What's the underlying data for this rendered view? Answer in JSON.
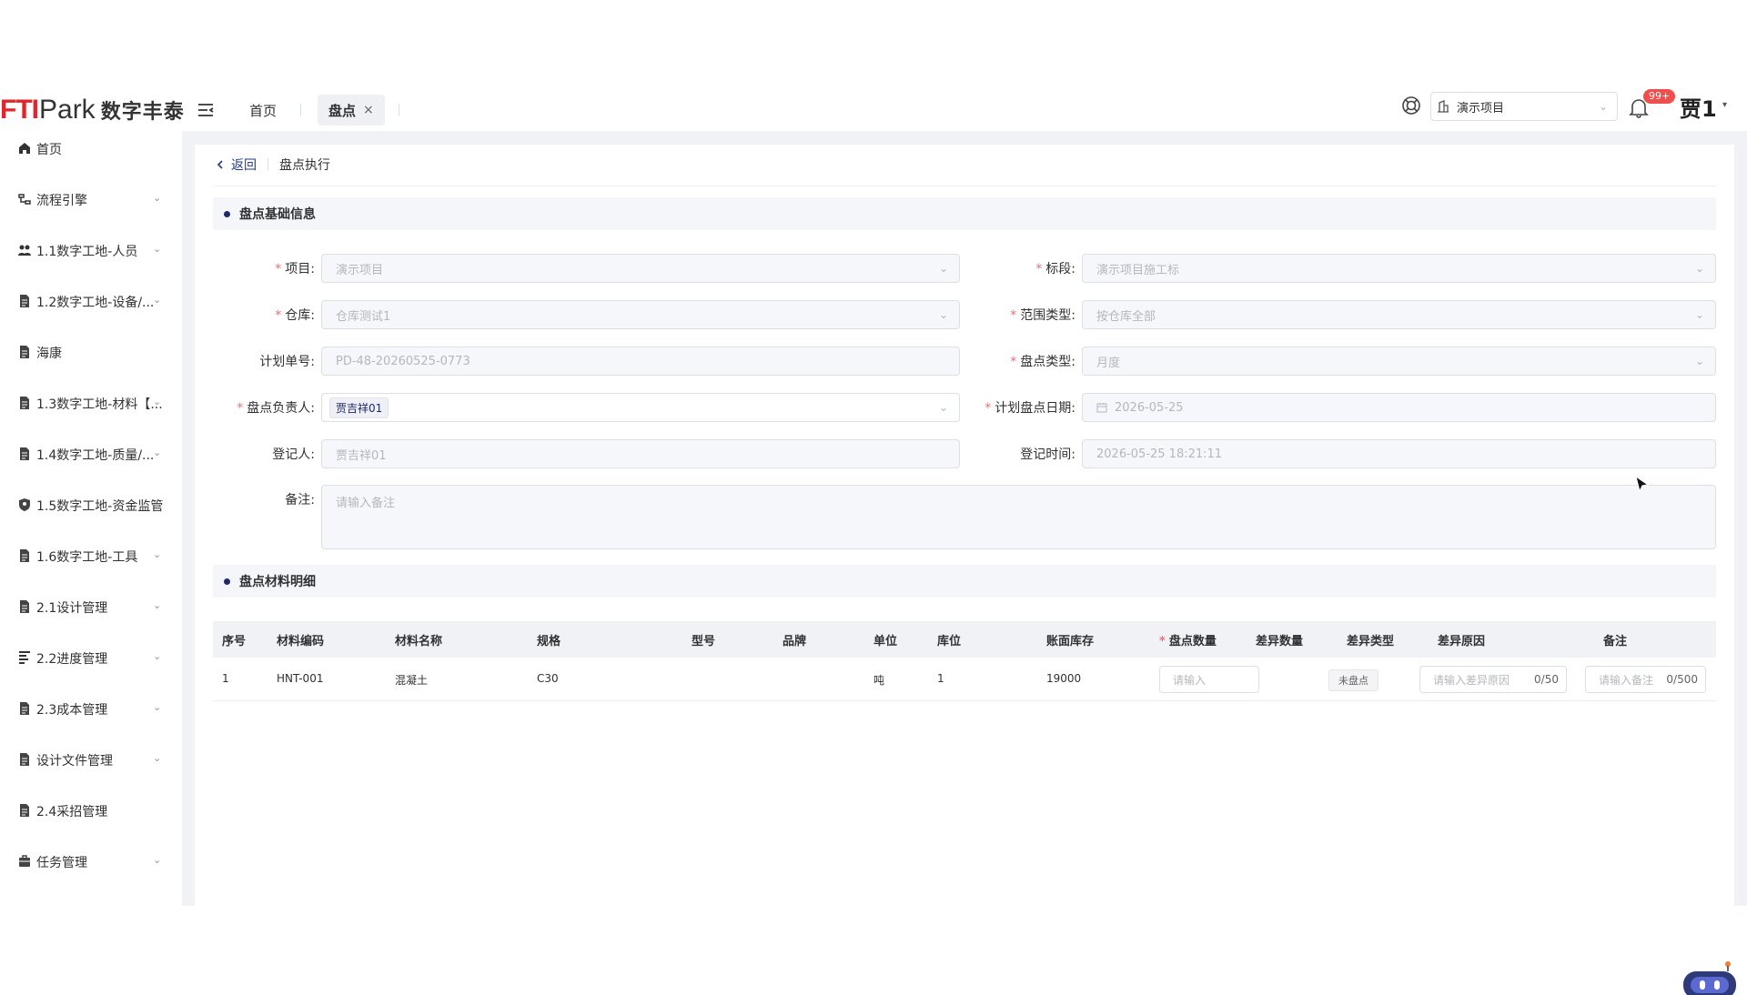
{
  "header": {
    "logo_ft": "FTI",
    "logo_park": "Park",
    "logo_cn": "数字丰泰",
    "tabs": [
      {
        "label": "首页"
      },
      {
        "label": "盘点"
      }
    ],
    "tab_close": "×",
    "project_select": "演示项目",
    "notification_badge": "99+",
    "user_name": "贾1",
    "user_caret": "▾"
  },
  "sidebar": {
    "items": [
      {
        "label": "首页",
        "icon": "home-icon",
        "has_arrow": false
      },
      {
        "label": "流程引擎",
        "icon": "workflow-icon",
        "has_arrow": true
      },
      {
        "label": "1.1数字工地-人员",
        "icon": "people-icon",
        "has_arrow": true
      },
      {
        "label": "1.2数字工地-设备/...",
        "icon": "document-icon",
        "has_arrow": true
      },
      {
        "label": "海康",
        "icon": "document-icon",
        "has_arrow": false
      },
      {
        "label": "1.3数字工地-材料【...",
        "icon": "document-icon",
        "has_arrow": true
      },
      {
        "label": "1.4数字工地-质量/...",
        "icon": "document-icon",
        "has_arrow": true
      },
      {
        "label": "1.5数字工地-资金监管",
        "icon": "shield-icon",
        "has_arrow": false
      },
      {
        "label": "1.6数字工地-工具",
        "icon": "document-icon",
        "has_arrow": true
      },
      {
        "label": "2.1设计管理",
        "icon": "document-icon",
        "has_arrow": true
      },
      {
        "label": "2.2进度管理",
        "icon": "progress-icon",
        "has_arrow": true
      },
      {
        "label": "2.3成本管理",
        "icon": "document-icon",
        "has_arrow": true
      },
      {
        "label": "设计文件管理",
        "icon": "document-icon",
        "has_arrow": true
      },
      {
        "label": "2.4采招管理",
        "icon": "document-icon",
        "has_arrow": false
      },
      {
        "label": "任务管理",
        "icon": "briefcase-icon",
        "has_arrow": true
      }
    ]
  },
  "breadcrumb": {
    "back": "返回",
    "current": "盘点执行"
  },
  "sections": {
    "basic": "盘点基础信息",
    "detail": "盘点材料明细"
  },
  "form": {
    "project": {
      "label": "项目:",
      "value": "演示项目",
      "required": true
    },
    "section": {
      "label": "标段:",
      "value": "演示项目施工标",
      "required": true
    },
    "warehouse": {
      "label": "仓库:",
      "value": "仓库测试1",
      "required": true
    },
    "scope_type": {
      "label": "范围类型:",
      "value": "按仓库全部",
      "required": true
    },
    "plan_no": {
      "label": "计划单号:",
      "value": "PD-48-20260525-0773",
      "required": false
    },
    "count_type": {
      "label": "盘点类型:",
      "value": "月度",
      "required": true
    },
    "owner": {
      "label": "盘点负责人:",
      "value": "贾吉祥01",
      "required": true
    },
    "plan_date": {
      "label": "计划盘点日期:",
      "value": "2026-05-25",
      "required": true
    },
    "registrar": {
      "label": "登记人:",
      "value": "贾吉祥01",
      "required": false
    },
    "register_time": {
      "label": "登记时间:",
      "value": "2026-05-25 18:21:11",
      "required": false
    },
    "remark": {
      "label": "备注:",
      "placeholder": "请输入备注"
    }
  },
  "table": {
    "columns": [
      "序号",
      "材料编码",
      "材料名称",
      "规格",
      "型号",
      "品牌",
      "单位",
      "库位",
      "账面库存",
      "盘点数量",
      "差异数量",
      "差异类型",
      "差异原因",
      "备注"
    ],
    "required_column": "*",
    "rows": [
      {
        "index": "1",
        "code": "HNT-001",
        "name": "混凝土",
        "spec": "C30",
        "model": "",
        "brand": "",
        "unit": "吨",
        "location": "1",
        "book_stock": "19000",
        "count_placeholder": "请输入",
        "diff_qty": "",
        "diff_type": "未盘点",
        "reason_placeholder": "请输入差异原因",
        "reason_count": "0/50",
        "remark_placeholder": "请输入备注",
        "remark_count": "0/500"
      }
    ]
  },
  "colors": {
    "brand_red": "#e0262d",
    "accent": "#1f2a6b",
    "required": "#f56c6c",
    "badge": "#f04d4d"
  }
}
